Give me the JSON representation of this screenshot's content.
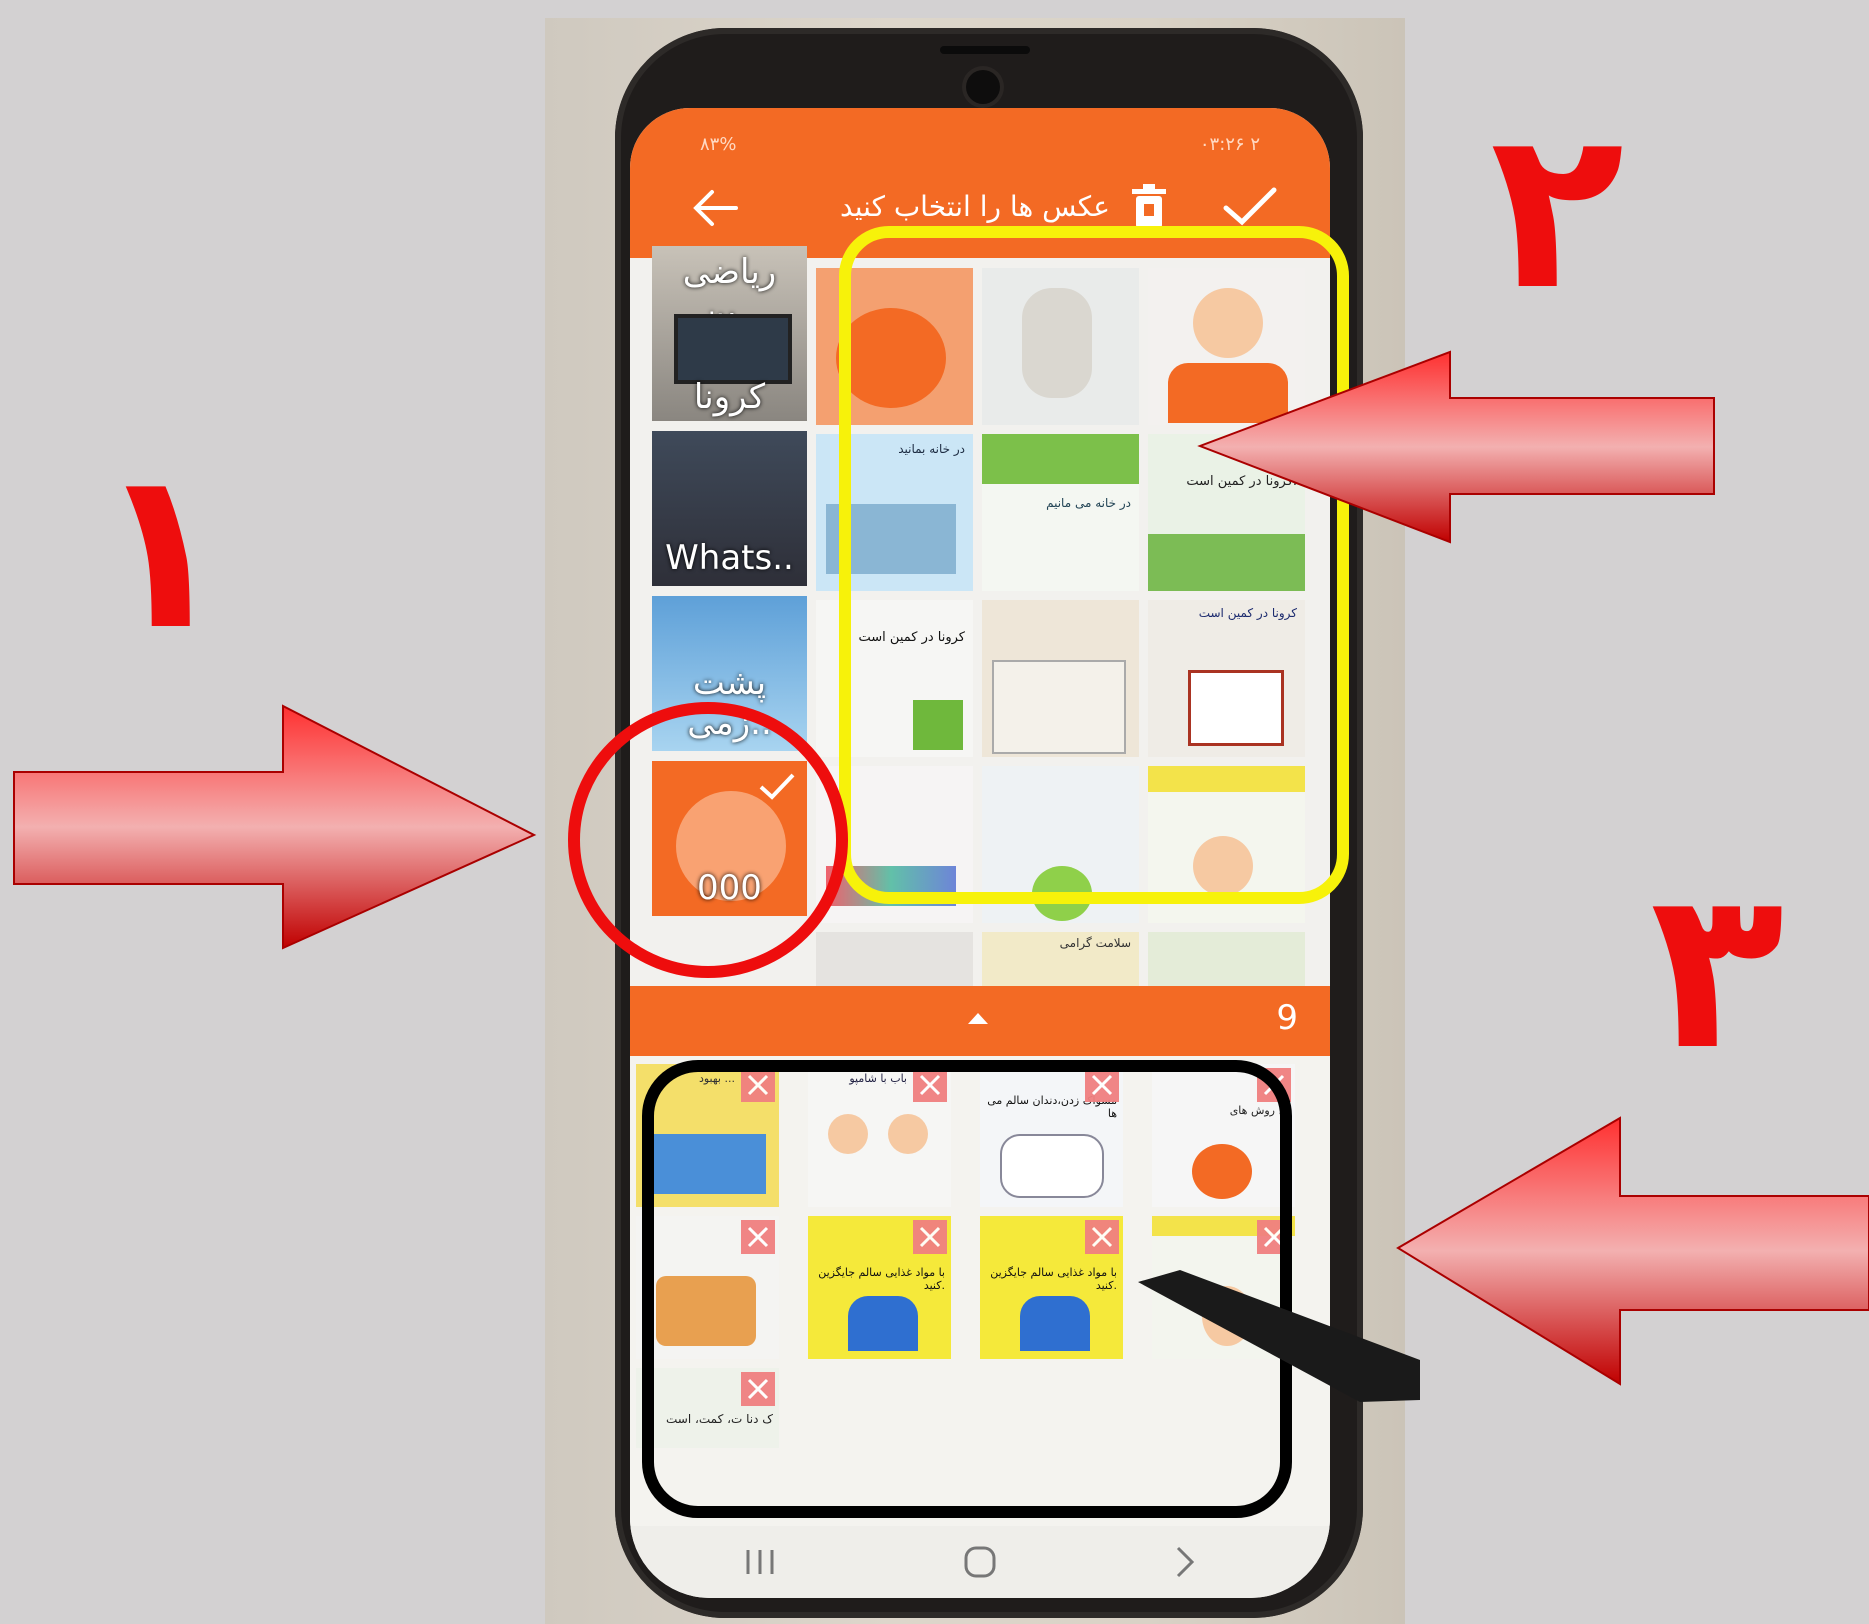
{
  "status_bar": {
    "left": "۸۳% ",
    "right": "۰۳:۲۶ ۲"
  },
  "toolbar": {
    "title": "عکس ها را انتخاب کنید",
    "back_icon": "arrow-left-icon",
    "delete_icon": "trash-icon",
    "confirm_icon": "check-icon"
  },
  "albums": [
    {
      "label": "ریاضی پن.."
    },
    {
      "label": "کرونا"
    },
    {
      "label": "Whats.."
    },
    {
      "label": "پشت زمی.."
    },
    {
      "label": "000",
      "checked": true
    }
  ],
  "gallery_captions": {
    "r2c2": "در خانه بمانید",
    "r2c3": "در خانه می مانیم",
    "r2c4": "کرونا در کمین است.",
    "r3c2": "کرونا در کمین است",
    "r3c4": "کرونا در کمین است",
    "r5c3": "سلامت گرامی"
  },
  "selection": {
    "count": "9",
    "expand_icon": "caret-up-icon"
  },
  "selected_items": [
    {
      "caption": "بهبود ..."
    },
    {
      "caption": "باب با شامپو"
    },
    {
      "caption": "مسواک زدن،دندان سالم می ها"
    },
    {
      "caption": "روش های ..."
    },
    {
      "caption": ""
    },
    {
      "caption": "با مواد غذایی سالم جایگزین کنید."
    },
    {
      "caption": "با مواد غذایی سالم جایگزین کنید."
    },
    {
      "caption": ""
    },
    {
      "caption": "ک دنا ت، کمت، است"
    }
  ],
  "annotations": {
    "one": "۱",
    "two": "۲",
    "three": "۳"
  },
  "colors": {
    "accent": "#f36a24",
    "annotation_red": "#ee0d0d",
    "highlight_yellow": "#f7f20a",
    "outline_black": "#000000"
  },
  "navbar": {
    "recent_icon": "recent-apps-icon",
    "home_icon": "home-icon",
    "back_icon": "nav-back-icon"
  }
}
